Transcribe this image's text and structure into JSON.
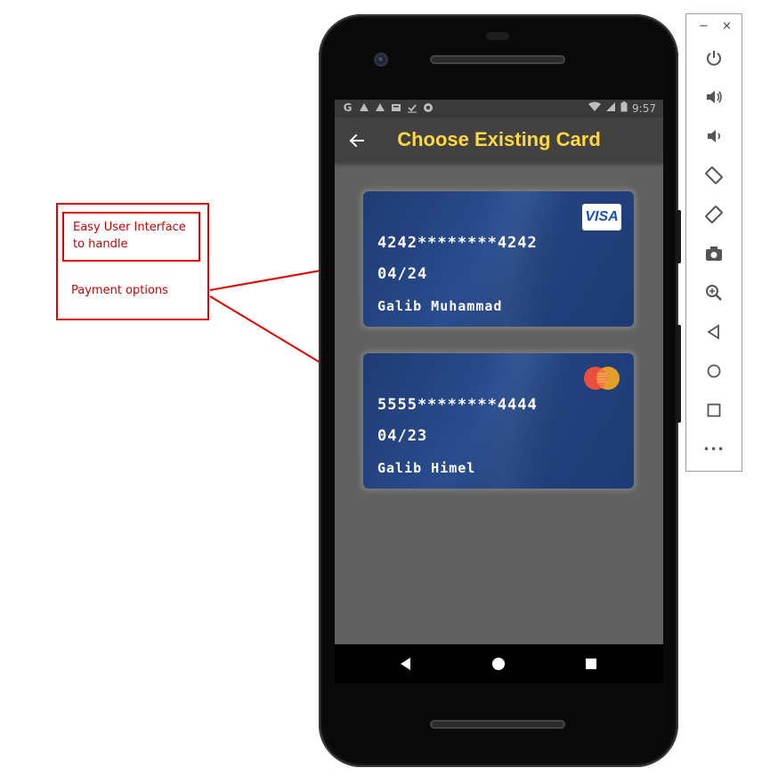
{
  "annotation": {
    "box_label": "Easy User Interface\nto handle",
    "note": "Payment options",
    "color": "#e00000"
  },
  "statusbar": {
    "left_icons": [
      "G",
      "drive-icon",
      "drive-icon",
      "news-icon",
      "check-download-icon",
      "record-icon"
    ],
    "time": "9:57"
  },
  "appbar": {
    "back_icon": "arrow-left-icon",
    "title": "Choose Existing Card",
    "title_color": "#ffd740"
  },
  "cards": [
    {
      "brand": "VISA",
      "number": "4242********4242",
      "expiry": "04/24",
      "holder": "Galib Muhammad"
    },
    {
      "brand": "mastercard",
      "number": "5555********4444",
      "expiry": "04/23",
      "holder": "Galib Himel"
    }
  ],
  "navbar": {
    "buttons": [
      "back-triangle-icon",
      "home-circle-icon",
      "recents-square-icon"
    ]
  },
  "emulator_toolbar": {
    "minimize": "−",
    "close": "×",
    "more": "•••",
    "buttons": [
      "power-icon",
      "volume-up-icon",
      "volume-down-icon",
      "rotate-left-icon",
      "rotate-right-icon",
      "camera-icon",
      "zoom-icon",
      "back-icon",
      "home-icon",
      "overview-icon",
      "more-icon"
    ]
  }
}
